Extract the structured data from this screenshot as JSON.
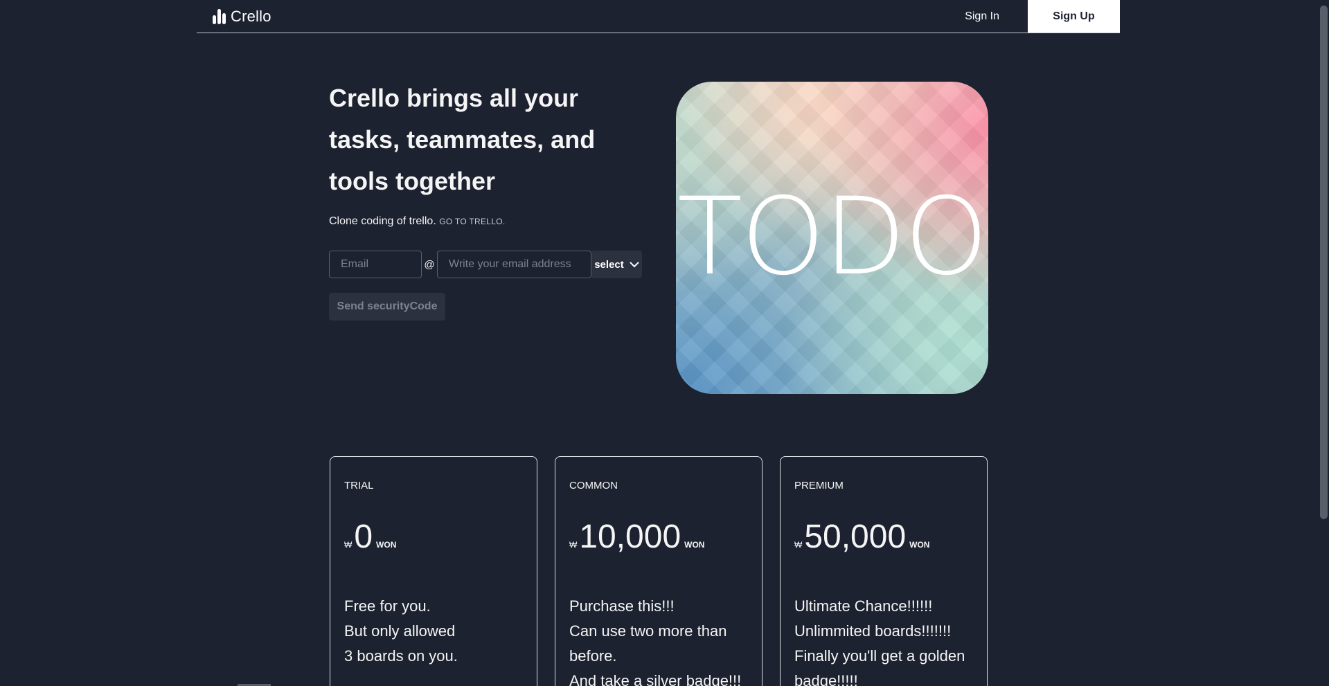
{
  "header": {
    "logo_text": "Crello",
    "sign_in": "Sign In",
    "sign_up": "Sign Up"
  },
  "hero": {
    "title": "Crello brings all your tasks, teammates, and tools together",
    "subtitle": "Clone coding of trello.",
    "link": "GO TO TRELLO."
  },
  "form": {
    "email_placeholder": "Email",
    "at": "@",
    "domain_placeholder": "Write your email address",
    "select_label": "select",
    "send_button": "Send securityCode"
  },
  "hero_image": {
    "text": "TODO"
  },
  "plans": [
    {
      "name": "TRIAL",
      "currency": "₩",
      "amount": "0",
      "unit": "WON",
      "lines": [
        "Free for you.",
        "But only allowed",
        "3 boards on you."
      ]
    },
    {
      "name": "COMMON",
      "currency": "₩",
      "amount": "10,000",
      "unit": "WON",
      "lines": [
        "Purchase this!!!",
        "Can use two more than",
        "before.",
        "And take a silver badge!!!"
      ]
    },
    {
      "name": "PREMIUM",
      "currency": "₩",
      "amount": "50,000",
      "unit": "WON",
      "lines": [
        "Ultimate Chance!!!!!!",
        "Unlimmited boards!!!!!!!",
        "Finally you'll get a golden",
        "badge!!!!!"
      ]
    }
  ],
  "colors": {
    "background": "#1d2230",
    "text": "#f5f5f5",
    "button_muted": "#2c3140"
  },
  "icons": {
    "logo": "bar-chart-icon",
    "select": "chevron-down-icon"
  }
}
